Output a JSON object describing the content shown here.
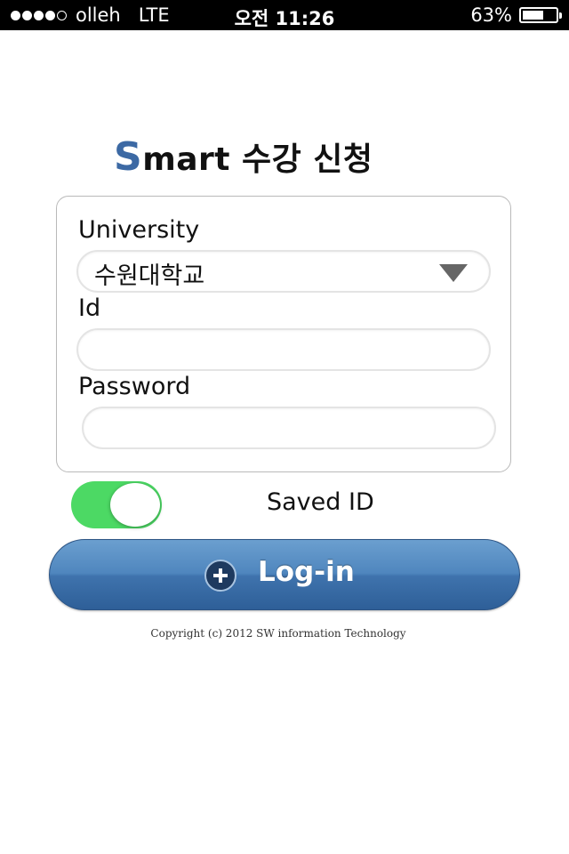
{
  "status_bar": {
    "signal_bars_filled": 4,
    "signal_bars_total": 5,
    "carrier": "olleh",
    "network": "LTE",
    "time": "오전 11:26",
    "battery_text": "63%",
    "battery_level": 0.63
  },
  "header": {
    "title_accent": "S",
    "title_rest": "mart 수강 신청",
    "accent_color": "#3c69a4"
  },
  "form": {
    "university_label": "University",
    "university_value": "수원대학교",
    "id_label": "Id",
    "id_value": "",
    "password_label": "Password",
    "password_value": ""
  },
  "saved_id": {
    "label": "Saved ID",
    "enabled": true,
    "toggle_color": "#4cd964"
  },
  "login_button": {
    "label": "Log-in",
    "icon": "plus-circle-icon",
    "color": "#4a7fb8"
  },
  "footer": {
    "copyright": "Copyright (c) 2012 SW information Technology"
  }
}
